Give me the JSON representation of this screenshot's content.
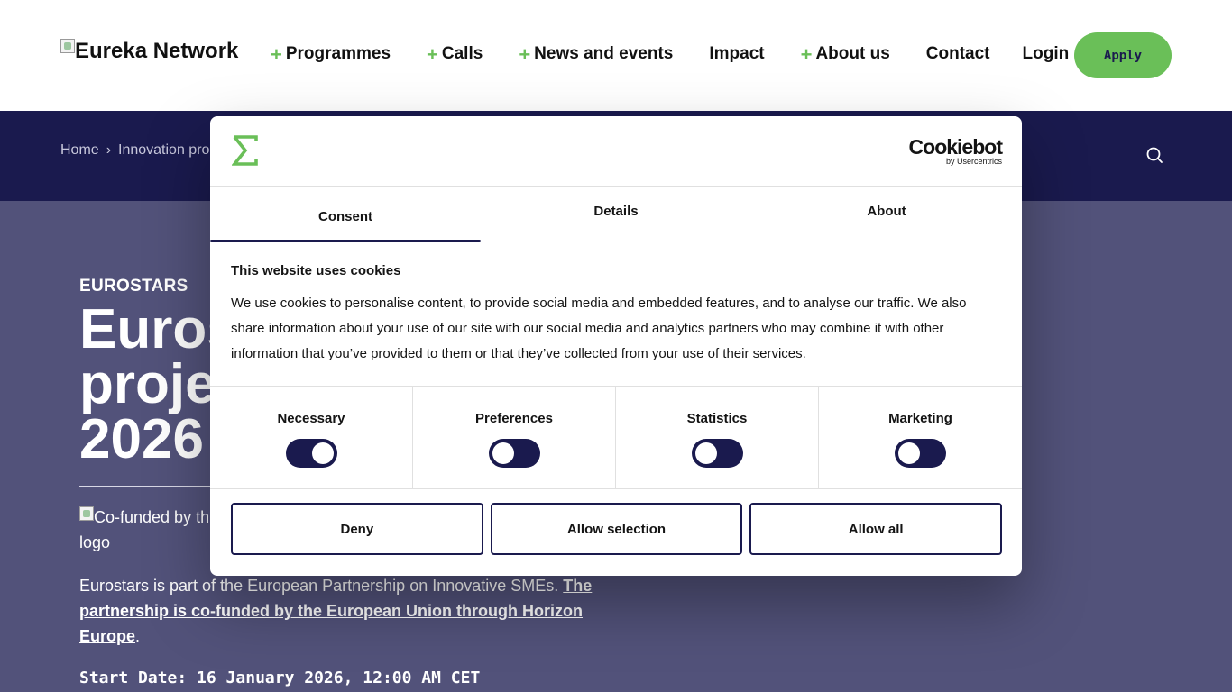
{
  "header": {
    "logo_text": "Eureka Network",
    "nav": [
      {
        "label": "Programmes",
        "has_plus": true
      },
      {
        "label": "Calls",
        "has_plus": true
      },
      {
        "label": "News and events",
        "has_plus": true
      },
      {
        "label": "Impact",
        "has_plus": false
      },
      {
        "label": "About us",
        "has_plus": true
      },
      {
        "label": "Contact",
        "has_plus": false
      },
      {
        "label": "Login",
        "has_plus": false
      }
    ],
    "plus_symbol": "+",
    "apply_label": "Apply",
    "accent_color": "#6abf58"
  },
  "band": {
    "breadcrumb_home": "Home",
    "breadcrumb_sep": "›",
    "breadcrumb_current": "Innovation pro",
    "background": "#1a1a4e"
  },
  "hero": {
    "eyebrow": "EUROSTARS",
    "title_lines": [
      "Euros",
      "proje",
      "2026"
    ],
    "cofund_alt": "Co-funded by th",
    "cofund_alt_2": "logo",
    "para_text": "Eurostars is part of the European Partnership on Innovative SMEs. ",
    "para_link": "The partnership is co-funded by the European Union through Horizon Europe",
    "para_end": ".",
    "start_date": "Start Date: 16 January 2026, 12:00 AM CET",
    "background": "#52527a"
  },
  "dialog": {
    "brand_main": "Cookiebot",
    "brand_sub": "by Usercentrics",
    "tabs": [
      "Consent",
      "Details",
      "About"
    ],
    "heading": "This website uses cookies",
    "body": "We use cookies to personalise content, to provide social media and embedded features, and to analyse our traffic. We also share information about your use of our site with our social media and analytics partners who may combine it with other information that you’ve provided to them or that they’ve collected from your use of their services.",
    "preferences": [
      {
        "label": "Necessary",
        "enabled": true
      },
      {
        "label": "Preferences",
        "enabled": false
      },
      {
        "label": "Statistics",
        "enabled": false
      },
      {
        "label": "Marketing",
        "enabled": false
      }
    ],
    "buttons": {
      "deny": "Deny",
      "allow_selection": "Allow selection",
      "allow_all": "Allow all"
    }
  }
}
